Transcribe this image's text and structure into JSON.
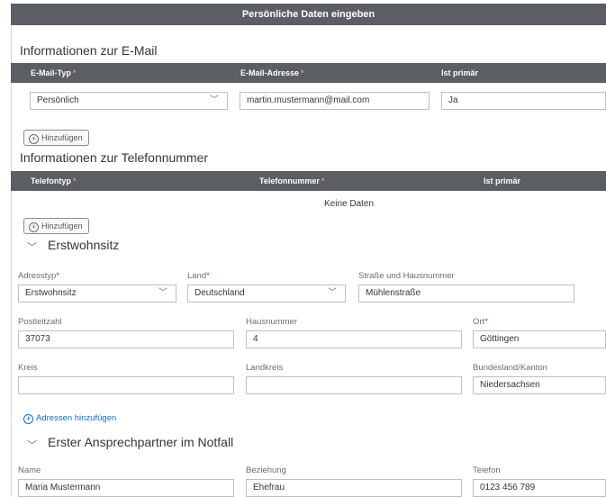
{
  "dialog": {
    "title": "Persönliche Daten eingeben"
  },
  "email": {
    "section_title": "Informationen zur E-Mail",
    "columns": {
      "type": "E-Mail-Typ",
      "address": "E-Mail-Adresse",
      "primary": "Ist primär"
    },
    "row": {
      "type": "Persönlich",
      "address": "martin.mustermann@mail.com",
      "primary": "Ja"
    },
    "add_label": "Hinzufügen"
  },
  "phone": {
    "section_title": "Informationen zur Telefonnummer",
    "columns": {
      "type": "Telefontyp",
      "number": "Telefonnummer",
      "primary": "Ist primär"
    },
    "empty_text": "Keine Daten",
    "add_label": "Hinzufügen"
  },
  "address": {
    "section_title": "Erstwohnsitz",
    "fields": {
      "address_type": {
        "label": "Adresstyp",
        "value": "Erstwohnsitz"
      },
      "country": {
        "label": "Land",
        "value": "Deutschland"
      },
      "street": {
        "label": "Straße und Hausnummer",
        "value": "Mühlenstraße"
      },
      "postal_code": {
        "label": "Postleitzahl",
        "value": "37073"
      },
      "house_number": {
        "label": "Hausnummer",
        "value": "4"
      },
      "city": {
        "label": "Ort",
        "value": "Göttingen"
      },
      "district": {
        "label": "Kreis",
        "value": ""
      },
      "rural_district": {
        "label": "Landkreis",
        "value": ""
      },
      "state": {
        "label": "Bundesland/Kanton",
        "value": "Niedersachsen"
      }
    },
    "add_link": "Adressen hinzufügen"
  },
  "emergency": {
    "section_title": "Erster Ansprechpartner im Notfall",
    "fields": {
      "name": {
        "label": "Name",
        "value": "Maria Mustermann"
      },
      "relation": {
        "label": "Beziehung",
        "value": "Ehefrau"
      },
      "phone": {
        "label": "Telefon",
        "value": "0123 456 789"
      }
    }
  },
  "icons": {
    "dropdown": "chevron-down-icon",
    "add": "plus-circle-icon",
    "collapse": "chevron-down-icon"
  },
  "colors": {
    "header_bg": "#5b5e62",
    "link": "#0a6ed1",
    "required": "#c0392b"
  }
}
